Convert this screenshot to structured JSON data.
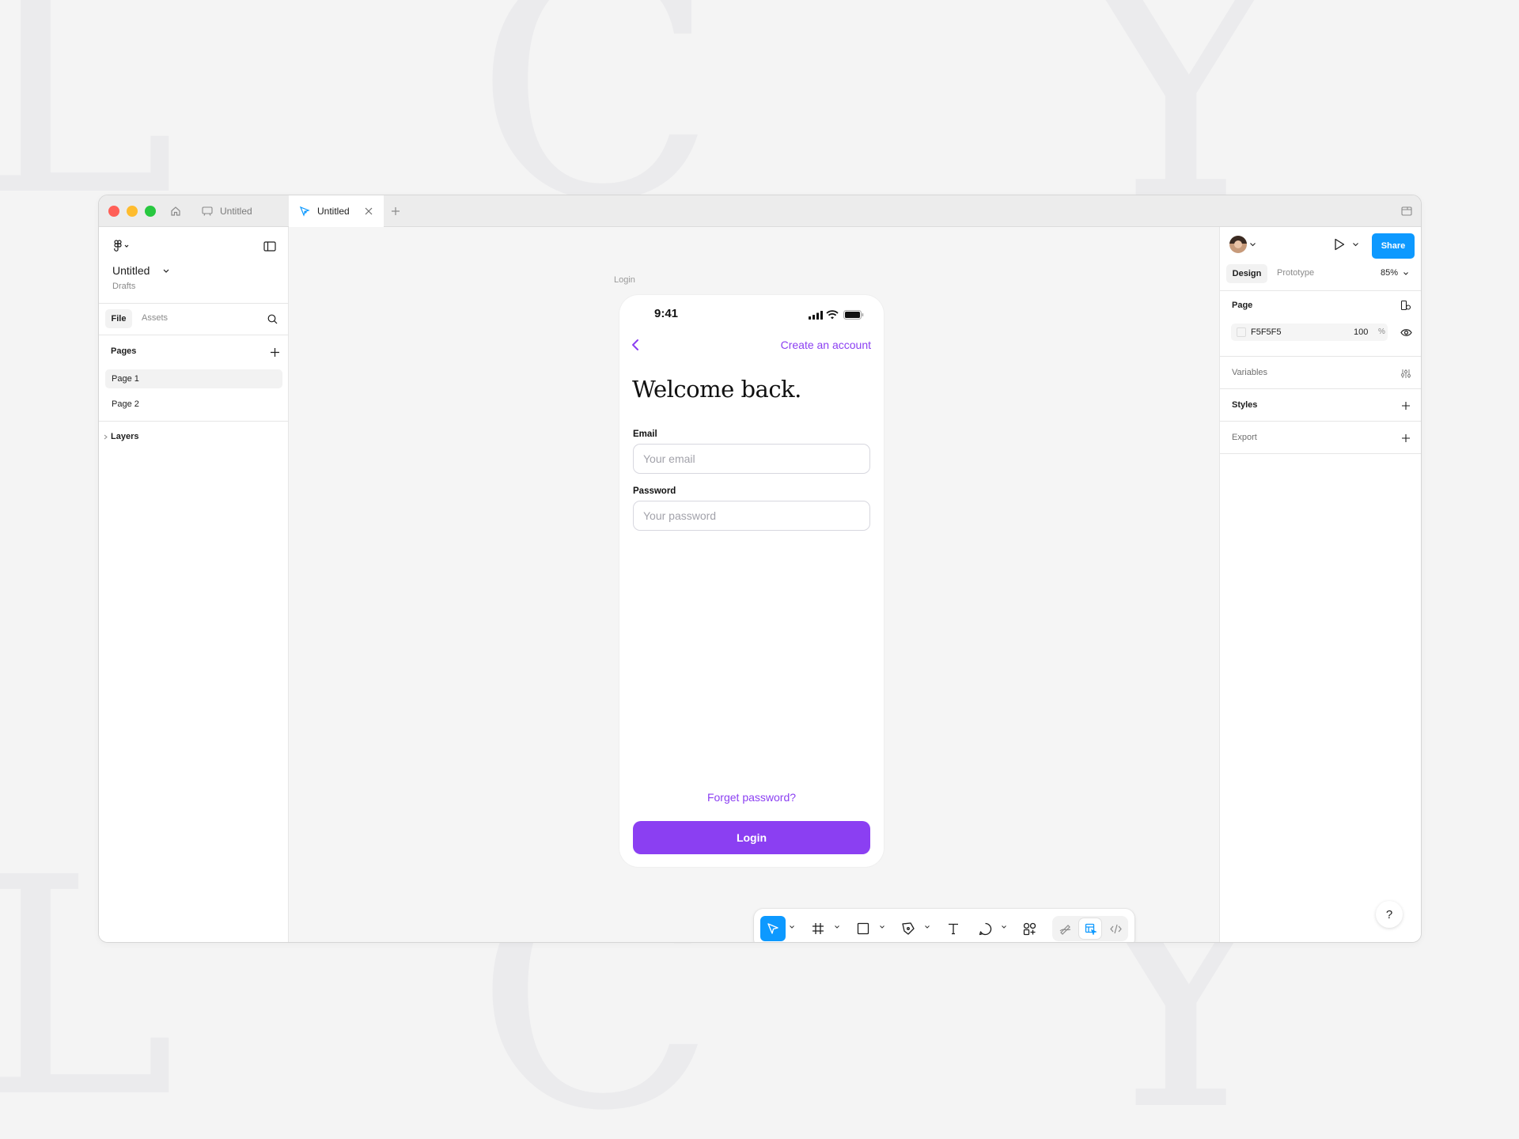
{
  "colors": {
    "accent_purple": "#8b3ff2",
    "brand_blue": "#0d99ff",
    "close": "#ff5f57",
    "minimize": "#febc2e",
    "zoom": "#28c840"
  },
  "titlebar": {
    "tabs": [
      {
        "label": "Untitled",
        "icon": "whiteboard-icon"
      },
      {
        "label": "Untitled",
        "icon": "design-file-icon"
      }
    ]
  },
  "left": {
    "file_name": "Untitled",
    "location": "Drafts",
    "tabs": [
      "File",
      "Assets"
    ],
    "pages_heading": "Pages",
    "pages": [
      "Page 1",
      "Page 2"
    ],
    "layers_heading": "Layers"
  },
  "right": {
    "share_label": "Share",
    "tabs": [
      "Design",
      "Prototype"
    ],
    "zoom": "85%",
    "page_heading": "Page",
    "page_color": "F5F5F5",
    "page_opacity": "100",
    "percent": "%",
    "variables": "Variables",
    "styles": "Styles",
    "export": "Export"
  },
  "canvas": {
    "frame_label": "Login",
    "phone": {
      "time": "9:41",
      "create_account": "Create an account",
      "heading": "Welcome back.",
      "email_label": "Email",
      "email_placeholder": "Your email",
      "password_label": "Password",
      "password_placeholder": "Your password",
      "forgot": "Forget password?",
      "login": "Login"
    }
  },
  "help": "?"
}
